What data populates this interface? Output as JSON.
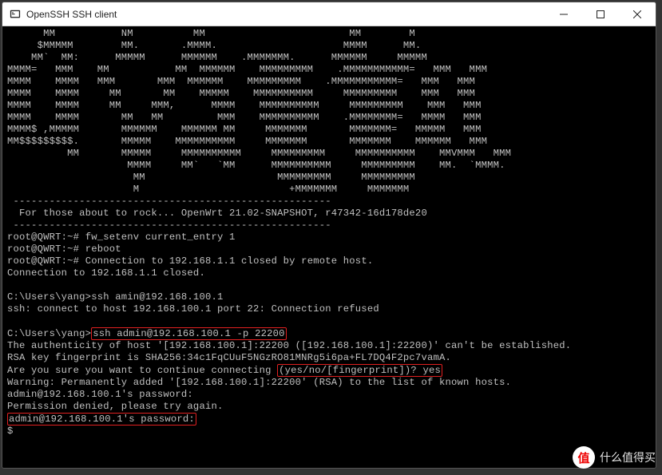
{
  "window": {
    "title": "OpenSSH SSH client"
  },
  "terminal": {
    "banner_lines": [
      "      MM           NM          MM                        MM        M",
      "     $MMMMM        MM.       .MMMM.                     MMMM      MM.",
      "    MM`  MM:      MMMMM      MMMMMM    .MMMMMMM.      MMMMMM     MMMMM",
      "MMMM=   MMM    MM           MM  MMMMMM    MMMMMMMMM    .MMMMMMMMMMM=   MMM   MMM",
      "MMMM    MMMM   MMM       MMM  MMMMMM    MMMMMMMMM    .MMMMMMMMMMM=   MMM   MMM",
      "MMMM    MMMM     MM       MM    MMMMM    MMMMMMMMMM     MMMMMMMMM    MMM   MMM",
      "MMMM    MMMM     MM     MMM,      MMMM    MMMMMMMMMM     MMMMMMMMM    MMM   MMM",
      "MMMM    MMMM       MM   MM         MMM    MMMMMMMMMM    .MMMMMMMM=   MMMM   MMM",
      "MMMM$ ,MMMMM       MMMMMM    MMMMMM MM     MMMMMMM       MMMMMMM=   MMMMM   MMM",
      "MM$$$$$$$$$.       MMMMM    MMMMMMMMMM     MMMMMMM       MMMMMMM    MMMMMM   MMM",
      "          MM       MMMMM     MMMMMMMMMM     MMMMMMMMM     MMMMMMMMMM    MMVMMM   MMM",
      "                    MMMM     MM`   `MM      MMMMMMMMMM     MMMMMMMMM    MM.  `MMMM.",
      "                     MM                      MMMMMMMMM     MMMMMMMMM",
      "                     M                         +MMMMMMM     MMMMMMM"
    ],
    "divider": " -----------------------------------------------------",
    "motd": "  For those about to rock... OpenWrt 21.02-SNAPSHOT, r47342-16d178de20",
    "cmd1_prompt": "root@QWRT:~# ",
    "cmd1": "fw_setenv current_entry 1",
    "cmd2_prompt": "root@QWRT:~# ",
    "cmd2": "reboot",
    "cmd3_prompt": "root@QWRT:~# ",
    "cmd3_msg": "Connection to 192.168.1.1 closed by remote host.",
    "closed_msg": "Connection to 192.168.1.1 closed.",
    "ssh1_prompt": "C:\\Users\\yang>",
    "ssh1_cmd": "ssh amin@192.168.100.1",
    "ssh1_err": "ssh: connect to host 192.168.100.1 port 22: Connection refused",
    "ssh2_prompt": "C:\\Users\\yang>",
    "ssh2_cmd": "ssh admin@192.168.100.1 -p 22200",
    "auth_line": "The authenticity of host '[192.168.100.1]:22200 ([192.168.100.1]:22200)' can't be established.",
    "rsa_line": "RSA key fingerprint is SHA256:34c1FqCUuF5NGzRO81MNRg5i6pa+FL7DQ4F2pc7vamA.",
    "continue_q": "Are you sure you want to continue connecting ",
    "continue_choices": "(yes/no/[fingerprint])? yes",
    "warning_line": "Warning: Permanently added '[192.168.100.1]:22200' (RSA) to the list of known hosts.",
    "pw1": "admin@192.168.100.1's password:",
    "denied": "Permission denied, please try again.",
    "pw2": "admin@192.168.100.1's password:",
    "cursor": "$"
  },
  "watermark": {
    "badge": "值",
    "text": "什么值得买"
  }
}
